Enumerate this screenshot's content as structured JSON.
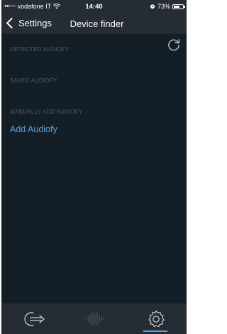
{
  "status_bar": {
    "signal": "●●○○○",
    "carrier": "vodafone IT",
    "wifi": "wifi-icon",
    "time": "14:40",
    "alarm": "alarm-icon",
    "battery_percent": "73%",
    "battery_level": 0.73
  },
  "nav": {
    "back_label": "Settings",
    "title": "Device finder"
  },
  "sections": {
    "detected": "DETECTED AUDIOFY",
    "saved": "SAVED AUDIOFY",
    "manual": "MANUALLY ADD AUDIOFY"
  },
  "actions": {
    "add_label": "Add Audiofy",
    "refresh_icon": "refresh-icon"
  },
  "tab_bar": {
    "tabs": [
      {
        "icon": "login-arrow-icon",
        "selected": false
      },
      {
        "icon": "waveform-icon",
        "selected": false
      },
      {
        "icon": "settings-gear-icon",
        "selected": true
      }
    ]
  },
  "colors": {
    "background": "#141e27",
    "bar": "#252c33",
    "accent": "#5aa0d8",
    "section_text": "#4d5a66"
  }
}
